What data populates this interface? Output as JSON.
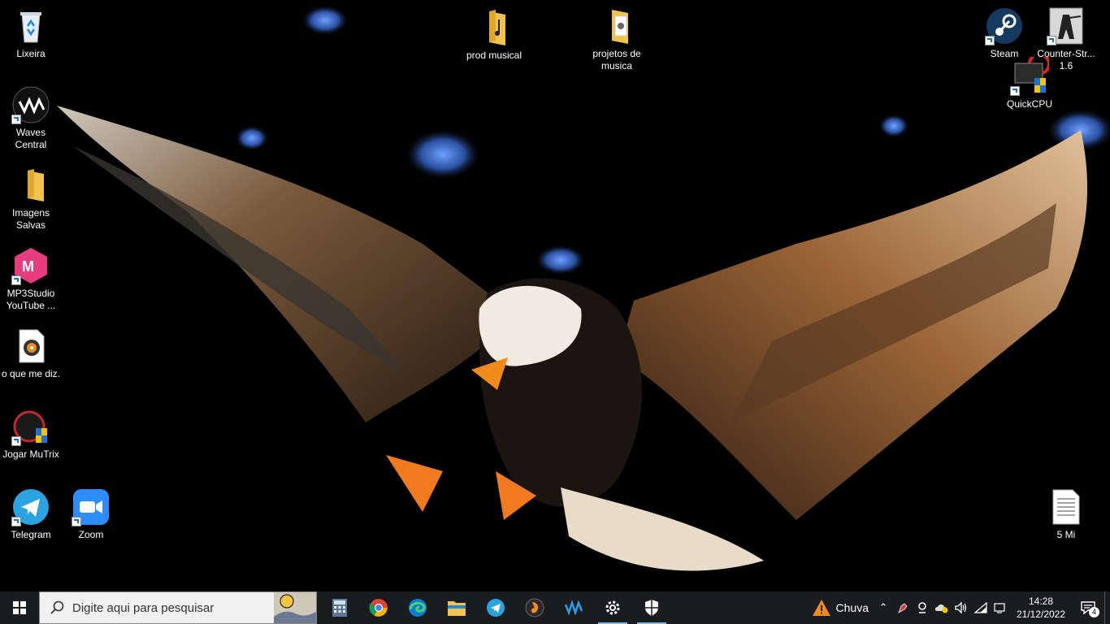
{
  "desktop": {
    "icons": [
      {
        "label": "Lixeira"
      },
      {
        "label": "Waves Central"
      },
      {
        "label": "Imagens Salvas"
      },
      {
        "label": "MP3Studio YouTube ..."
      },
      {
        "label": "o que me diz."
      },
      {
        "label": "Jogar MuTrix"
      },
      {
        "label": "Telegram"
      },
      {
        "label": "Zoom"
      },
      {
        "label": "prod musical"
      },
      {
        "label": "projetos de musica"
      },
      {
        "label": "Steam"
      },
      {
        "label": "Counter-Str... 1.6"
      },
      {
        "label": "QuickCPU"
      },
      {
        "label": "5 Mi"
      }
    ]
  },
  "taskbar": {
    "search_placeholder": "Digite aqui para pesquisar",
    "weather": "Chuva",
    "time": "14:28",
    "date": "21/12/2022",
    "notification_count": "4",
    "accent": "#76b9ed"
  }
}
